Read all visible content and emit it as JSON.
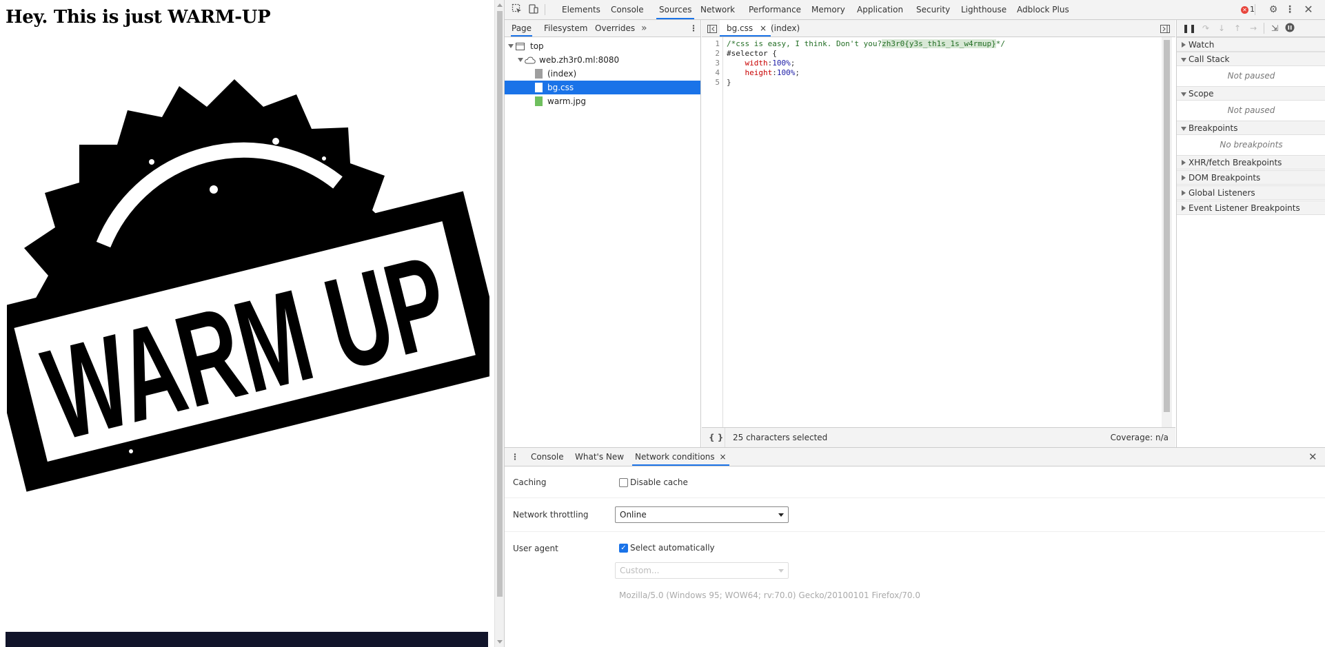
{
  "page": {
    "heading": "Hey. This is just WARM-UP",
    "stamp_text": "WARM UP"
  },
  "devtools": {
    "main_tabs": [
      "Elements",
      "Console",
      "Sources",
      "Network",
      "Performance",
      "Memory",
      "Application",
      "Security",
      "Lighthouse",
      "Adblock Plus"
    ],
    "active_main_tab": "Sources",
    "error_count": "1",
    "navigator": {
      "tabs": [
        "Page",
        "Filesystem",
        "Overrides"
      ],
      "more": "»",
      "tree": {
        "top": "top",
        "origin": "web.zh3r0.ml:8080",
        "files": [
          "(index)",
          "bg.css",
          "warm.jpg"
        ],
        "selected": "bg.css"
      }
    },
    "editor": {
      "tabs": [
        "bg.css",
        "(index)"
      ],
      "close_glyph": "×",
      "line_numbers": [
        "1",
        "2",
        "3",
        "4",
        "5"
      ],
      "lines": {
        "l1_comment_a": "/*css is easy, I think. Don't you?",
        "l1_selected": "zh3r0{y3s_th1s_1s_w4rmup}",
        "l1_comment_b": "*/",
        "l2": "#selector {",
        "l3_prop": "width",
        "l3_val": "100%",
        "l4_prop": "height",
        "l4_val": "100%",
        "l5": "}"
      },
      "status_format": "{ }",
      "status_selection": "25 characters selected",
      "status_coverage": "Coverage: n/a"
    },
    "debugger": {
      "panes": [
        {
          "title": "Watch",
          "expanded": false
        },
        {
          "title": "Call Stack",
          "expanded": true,
          "body": "Not paused"
        },
        {
          "title": "Scope",
          "expanded": true,
          "body": "Not paused"
        },
        {
          "title": "Breakpoints",
          "expanded": true,
          "body": "No breakpoints"
        },
        {
          "title": "XHR/fetch Breakpoints",
          "expanded": false
        },
        {
          "title": "DOM Breakpoints",
          "expanded": false
        },
        {
          "title": "Global Listeners",
          "expanded": false
        },
        {
          "title": "Event Listener Breakpoints",
          "expanded": false
        }
      ]
    },
    "drawer": {
      "tabs": [
        "Console",
        "What's New",
        "Network conditions"
      ],
      "active_tab": "Network conditions",
      "caching_label": "Caching",
      "disable_cache_label": "Disable cache",
      "disable_cache_checked": false,
      "throttling_label": "Network throttling",
      "throttling_value": "Online",
      "user_agent_label": "User agent",
      "select_auto_label": "Select automatically",
      "select_auto_checked": true,
      "custom_placeholder": "Custom...",
      "ua_string": "Mozilla/5.0 (Windows 95; WOW64; rv:70.0) Gecko/20100101 Firefox/70.0"
    }
  }
}
